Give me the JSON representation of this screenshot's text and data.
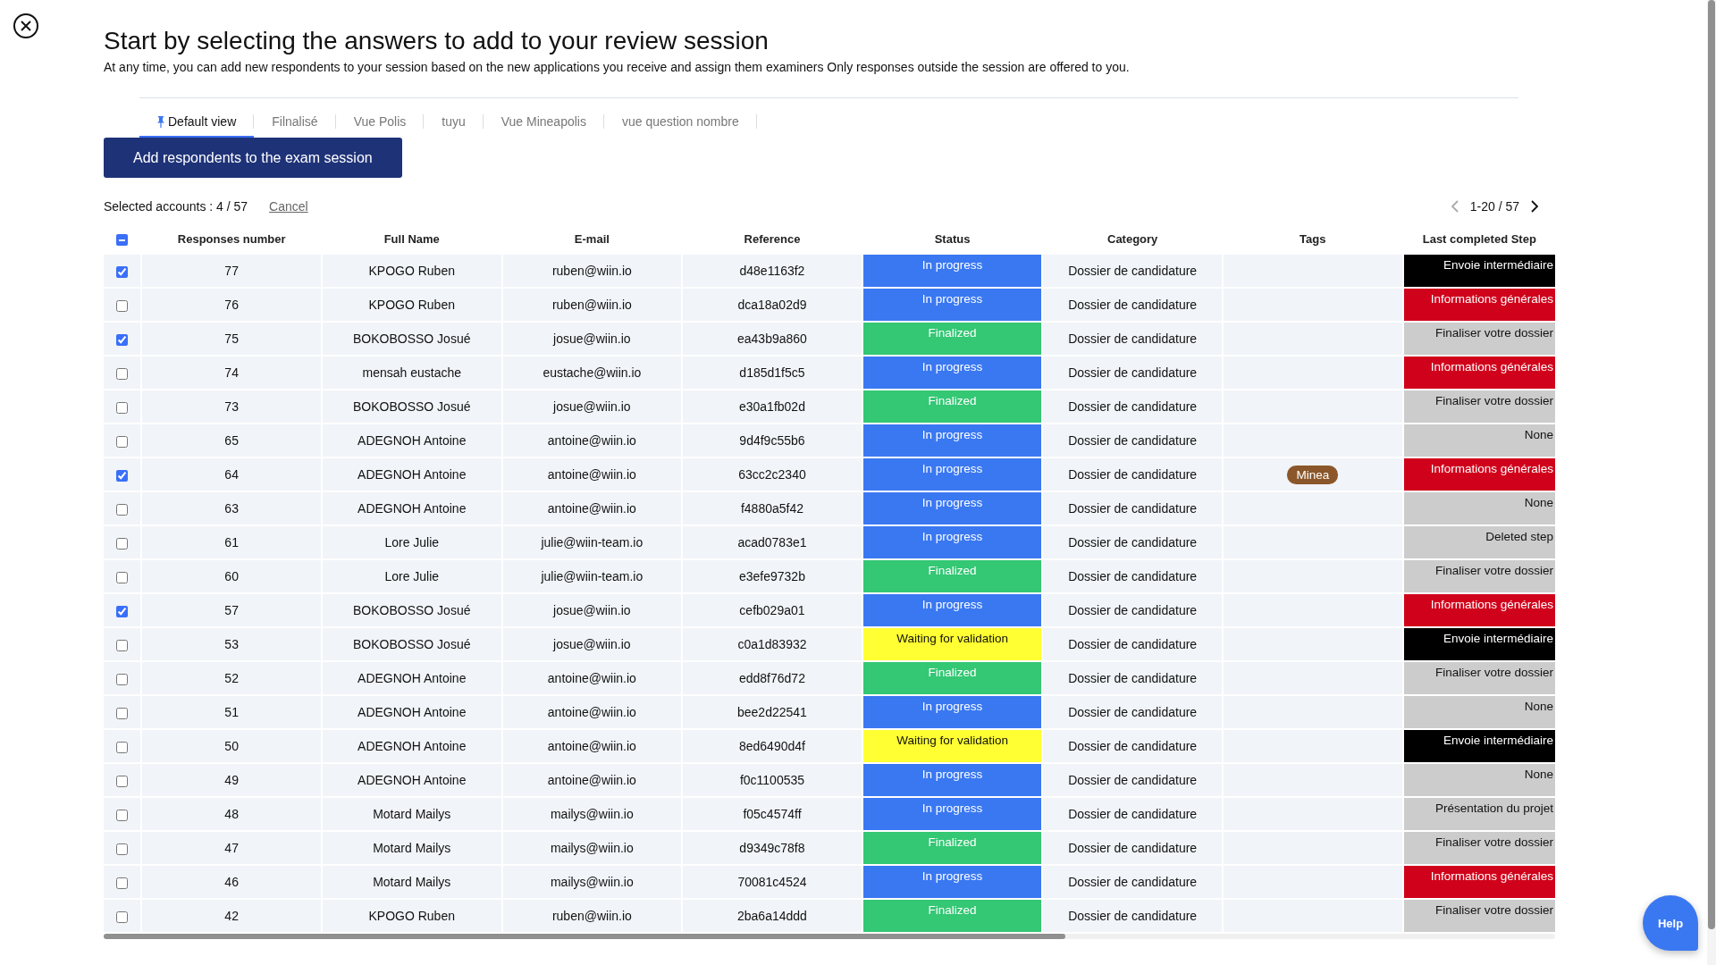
{
  "title": "Start by selecting the answers to add to your review session",
  "subtitle": "At any time, you can add new respondents to your session based on the new applications you receive and assign them examiners Only responses outside the session are offered to you.",
  "tabs": [
    {
      "label": "Default view",
      "selected": true,
      "pinned": true
    },
    {
      "label": "Filnalisé",
      "selected": false,
      "pinned": false
    },
    {
      "label": "Vue Polis",
      "selected": false,
      "pinned": false
    },
    {
      "label": "tuyu",
      "selected": false,
      "pinned": false
    },
    {
      "label": "Vue Mineapolis",
      "selected": false,
      "pinned": false
    },
    {
      "label": "vue question nombre",
      "selected": false,
      "pinned": false
    }
  ],
  "add_button": "Add respondents to the exam session",
  "selection": {
    "label": "Selected accounts : 4 / 57",
    "cancel": "Cancel"
  },
  "pagination": {
    "range": "1-20 / 57",
    "prev_disabled": true
  },
  "table": {
    "select_all_indeterminate": true,
    "columns": [
      "Responses number",
      "Full Name",
      "E-mail",
      "Reference",
      "Status",
      "Category",
      "Tags",
      "Last completed Step"
    ],
    "rows": [
      {
        "selected": true,
        "number": "77",
        "name": "KPOGO Ruben",
        "email": "ruben@wiin.io",
        "reference": "d48e1163f2",
        "status": {
          "label": "In progress",
          "kind": "progress"
        },
        "category": "Dossier de candidature",
        "step": {
          "label": "Envoie intermédiaire",
          "kind": "dark"
        }
      },
      {
        "selected": false,
        "number": "76",
        "name": "KPOGO Ruben",
        "email": "ruben@wiin.io",
        "reference": "dca18a02d9",
        "status": {
          "label": "In progress",
          "kind": "progress"
        },
        "category": "Dossier de candidature",
        "step": {
          "label": "Informations générales",
          "kind": "alert"
        }
      },
      {
        "selected": true,
        "number": "75",
        "name": "BOKOBOSSO Josué",
        "email": "josue@wiin.io",
        "reference": "ea43b9a860",
        "status": {
          "label": "Finalized",
          "kind": "done"
        },
        "category": "Dossier de candidature",
        "step": {
          "label": "Finaliser votre dossier",
          "kind": "neutral"
        }
      },
      {
        "selected": false,
        "number": "74",
        "name": "mensah eustache",
        "email": "eustache@wiin.io",
        "reference": "d185d1f5c5",
        "status": {
          "label": "In progress",
          "kind": "progress"
        },
        "category": "Dossier de candidature",
        "step": {
          "label": "Informations générales",
          "kind": "alert"
        }
      },
      {
        "selected": false,
        "number": "73",
        "name": "BOKOBOSSO Josué",
        "email": "josue@wiin.io",
        "reference": "e30a1fb02d",
        "status": {
          "label": "Finalized",
          "kind": "done"
        },
        "category": "Dossier de candidature",
        "step": {
          "label": "Finaliser votre dossier",
          "kind": "neutral"
        }
      },
      {
        "selected": false,
        "number": "65",
        "name": "ADEGNOH Antoine",
        "email": "antoine@wiin.io",
        "reference": "9d4f9c55b6",
        "status": {
          "label": "In progress",
          "kind": "progress"
        },
        "category": "Dossier de candidature",
        "step": {
          "label": "None",
          "kind": "neutral"
        }
      },
      {
        "selected": true,
        "number": "64",
        "name": "ADEGNOH Antoine",
        "email": "antoine@wiin.io",
        "reference": "63cc2c2340",
        "status": {
          "label": "In progress",
          "kind": "progress"
        },
        "category": "Dossier de candidature",
        "tags": [
          {
            "label": "Minea",
            "color": "#8b572a"
          }
        ],
        "step": {
          "label": "Informations générales",
          "kind": "alert"
        }
      },
      {
        "selected": false,
        "number": "63",
        "name": "ADEGNOH Antoine",
        "email": "antoine@wiin.io",
        "reference": "f4880a5f42",
        "status": {
          "label": "In progress",
          "kind": "progress"
        },
        "category": "Dossier de candidature",
        "step": {
          "label": "None",
          "kind": "neutral"
        }
      },
      {
        "selected": false,
        "number": "61",
        "name": "Lore Julie",
        "email": "julie@wiin-team.io",
        "reference": "acad0783e1",
        "status": {
          "label": "In progress",
          "kind": "progress"
        },
        "category": "Dossier de candidature",
        "step": {
          "label": "Deleted step",
          "kind": "neutral"
        }
      },
      {
        "selected": false,
        "number": "60",
        "name": "Lore Julie",
        "email": "julie@wiin-team.io",
        "reference": "e3efe9732b",
        "status": {
          "label": "Finalized",
          "kind": "done"
        },
        "category": "Dossier de candidature",
        "step": {
          "label": "Finaliser votre dossier",
          "kind": "neutral"
        }
      },
      {
        "selected": true,
        "number": "57",
        "name": "BOKOBOSSO Josué",
        "email": "josue@wiin.io",
        "reference": "cefb029a01",
        "status": {
          "label": "In progress",
          "kind": "progress"
        },
        "category": "Dossier de candidature",
        "step": {
          "label": "Informations générales",
          "kind": "alert"
        }
      },
      {
        "selected": false,
        "number": "53",
        "name": "BOKOBOSSO Josué",
        "email": "josue@wiin.io",
        "reference": "c0a1d83932",
        "status": {
          "label": "Waiting for validation",
          "kind": "waiting"
        },
        "category": "Dossier de candidature",
        "step": {
          "label": "Envoie intermédiaire",
          "kind": "dark"
        }
      },
      {
        "selected": false,
        "number": "52",
        "name": "ADEGNOH Antoine",
        "email": "antoine@wiin.io",
        "reference": "edd8f76d72",
        "status": {
          "label": "Finalized",
          "kind": "done"
        },
        "category": "Dossier de candidature",
        "step": {
          "label": "Finaliser votre dossier",
          "kind": "neutral"
        }
      },
      {
        "selected": false,
        "number": "51",
        "name": "ADEGNOH Antoine",
        "email": "antoine@wiin.io",
        "reference": "bee2d22541",
        "status": {
          "label": "In progress",
          "kind": "progress"
        },
        "category": "Dossier de candidature",
        "step": {
          "label": "None",
          "kind": "neutral"
        }
      },
      {
        "selected": false,
        "number": "50",
        "name": "ADEGNOH Antoine",
        "email": "antoine@wiin.io",
        "reference": "8ed6490d4f",
        "status": {
          "label": "Waiting for validation",
          "kind": "waiting"
        },
        "category": "Dossier de candidature",
        "step": {
          "label": "Envoie intermédiaire",
          "kind": "dark"
        }
      },
      {
        "selected": false,
        "number": "49",
        "name": "ADEGNOH Antoine",
        "email": "antoine@wiin.io",
        "reference": "f0c1100535",
        "status": {
          "label": "In progress",
          "kind": "progress"
        },
        "category": "Dossier de candidature",
        "step": {
          "label": "None",
          "kind": "neutral"
        }
      },
      {
        "selected": false,
        "number": "48",
        "name": "Motard Mailys",
        "email": "mailys@wiin.io",
        "reference": "f05c4574ff",
        "status": {
          "label": "In progress",
          "kind": "progress"
        },
        "category": "Dossier de candidature",
        "step": {
          "label": "Présentation du projet",
          "kind": "neutral"
        }
      },
      {
        "selected": false,
        "number": "47",
        "name": "Motard Mailys",
        "email": "mailys@wiin.io",
        "reference": "d9349c78f8",
        "status": {
          "label": "Finalized",
          "kind": "done"
        },
        "category": "Dossier de candidature",
        "step": {
          "label": "Finaliser votre dossier",
          "kind": "neutral"
        }
      },
      {
        "selected": false,
        "number": "46",
        "name": "Motard Mailys",
        "email": "mailys@wiin.io",
        "reference": "70081c4524",
        "status": {
          "label": "In progress",
          "kind": "progress"
        },
        "category": "Dossier de candidature",
        "step": {
          "label": "Informations générales",
          "kind": "alert"
        }
      },
      {
        "selected": false,
        "number": "42",
        "name": "KPOGO Ruben",
        "email": "ruben@wiin.io",
        "reference": "2ba6a14ddd",
        "status": {
          "label": "Finalized",
          "kind": "done"
        },
        "category": "Dossier de candidature",
        "step": {
          "label": "Finaliser votre dossier",
          "kind": "neutral"
        }
      }
    ]
  },
  "help_button": "Help"
}
